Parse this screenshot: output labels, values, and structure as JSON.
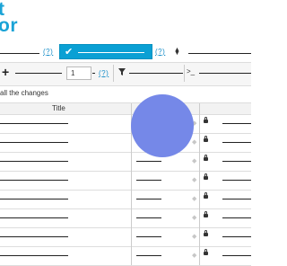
{
  "logo": {
    "line1": "t",
    "line2": "or"
  },
  "help_label": "(?)",
  "number_input": {
    "value": "1"
  },
  "terminal_label": ">_",
  "note": "all the changes",
  "table": {
    "header_title": "Title",
    "rows": [
      {
        "has_secondary": false
      },
      {
        "has_secondary": false
      },
      {
        "has_secondary": true
      },
      {
        "has_secondary": true
      },
      {
        "has_secondary": true
      },
      {
        "has_secondary": true
      },
      {
        "has_secondary": true
      },
      {
        "has_secondary": true
      }
    ]
  },
  "colors": {
    "accent": "#0aa0d4",
    "circle": "#7588e8",
    "logo": "#1aa3d6"
  }
}
